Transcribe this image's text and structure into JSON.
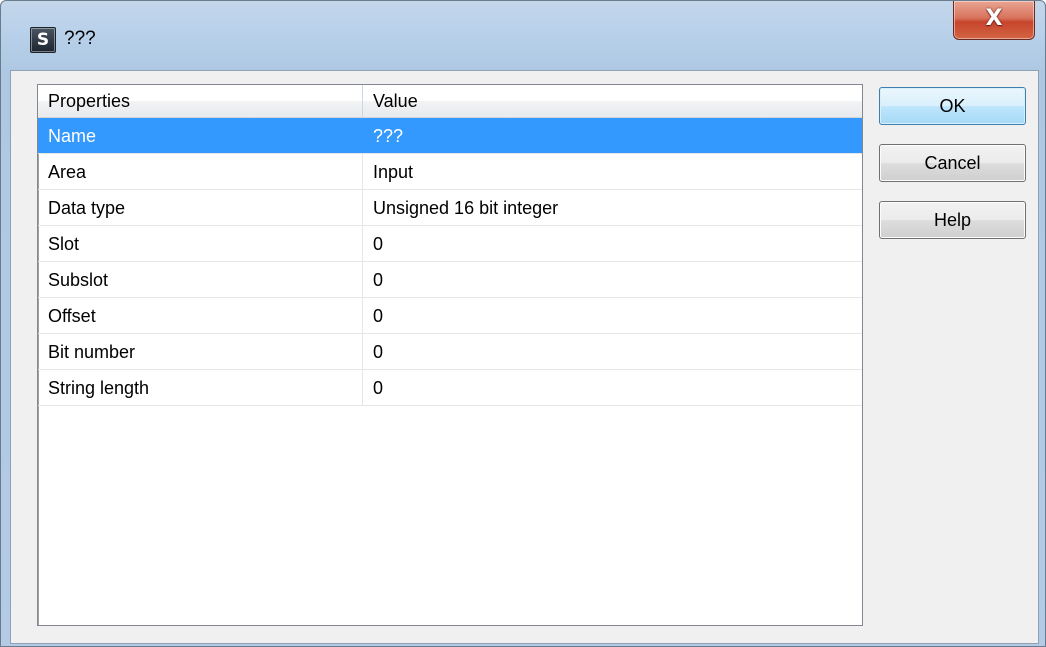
{
  "window": {
    "title": "???",
    "app_icon_letter": "S",
    "close_glyph": "X"
  },
  "table": {
    "columns": [
      "Properties",
      "Value"
    ],
    "rows": [
      {
        "property": "Name",
        "value": "???"
      },
      {
        "property": "Area",
        "value": "Input"
      },
      {
        "property": "Data type",
        "value": "Unsigned 16 bit integer"
      },
      {
        "property": "Slot",
        "value": "0"
      },
      {
        "property": "Subslot",
        "value": "0"
      },
      {
        "property": "Offset",
        "value": "0"
      },
      {
        "property": "Bit number",
        "value": "0"
      },
      {
        "property": "String length",
        "value": "0"
      }
    ],
    "selected_row": "Name"
  },
  "buttons": {
    "ok": "OK",
    "cancel": "Cancel",
    "help": "Help"
  },
  "colors": {
    "selection": "#3399ff",
    "close_button": "#c7452c",
    "title_bar": "#b9d1ea"
  }
}
